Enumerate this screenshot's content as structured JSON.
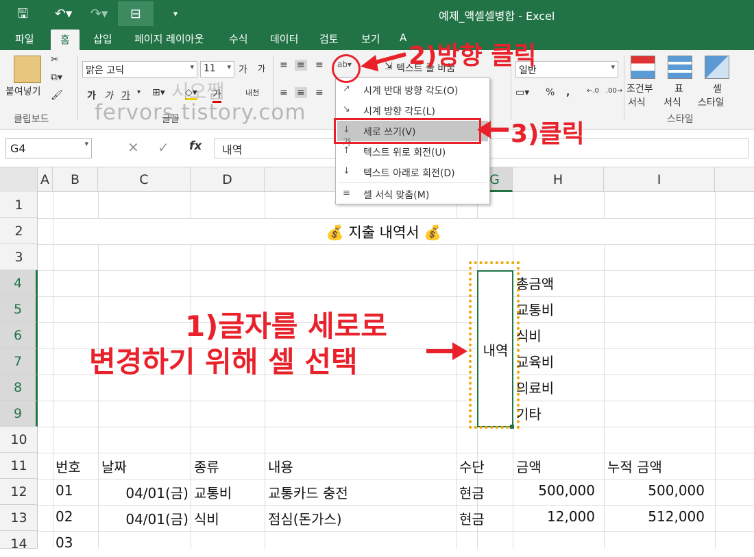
{
  "titlebar": {
    "title": "예제_액셀셀병합 - Excel"
  },
  "tabs": [
    "파일",
    "홈",
    "삽입",
    "페이지 레이아웃",
    "수식",
    "데이터",
    "검토",
    "보기",
    "A"
  ],
  "ribbon": {
    "paste_label": "붙여넣기",
    "clipboard_label": "클립보드",
    "font_name": "맑은 고딕",
    "font_size": "11",
    "font_group_label": "글꼴",
    "wrap_text": "텍스트 줄 바꿈",
    "number_format": "일반",
    "cond_format_1": "조건부",
    "cond_format_2": "서식",
    "table_format_1": "표",
    "table_format_2": "서식",
    "cell_style_1": "셀",
    "cell_style_2": "스타일",
    "style_group_label": "스타일",
    "bold": "가",
    "italic": "가",
    "underline": "가",
    "grow_font": "가",
    "shrink_font": "가",
    "font_color": "가",
    "phonetic": "내천",
    "percent": "%",
    "comma": ","
  },
  "formula": {
    "cell_ref": "G4",
    "value": "내역",
    "fx": "fx"
  },
  "columns": [
    "A",
    "B",
    "C",
    "D",
    "E",
    "F",
    "G",
    "H",
    "I"
  ],
  "rows": [
    "1",
    "2",
    "3",
    "4",
    "5",
    "6",
    "7",
    "8",
    "9",
    "10",
    "11",
    "12",
    "13",
    "14"
  ],
  "sheet": {
    "title": "💰 지출 내역서 💰",
    "merged_label": "내역",
    "categories": [
      "총금액",
      "교통비",
      "식비",
      "교육비",
      "의료비",
      "기타"
    ],
    "headers": {
      "no": "번호",
      "date": "날짜",
      "type": "종류",
      "content": "내용",
      "method": "수단",
      "amount": "금액",
      "cumulative": "누적 금액"
    },
    "records": [
      {
        "no": "01",
        "date": "04/01(금)",
        "type": "교통비",
        "content": "교통카드 충전",
        "method": "현금",
        "amount": "500,000",
        "cumulative": "500,000"
      },
      {
        "no": "02",
        "date": "04/01(금)",
        "type": "식비",
        "content": "점심(돈가스)",
        "method": "현금",
        "amount": "12,000",
        "cumulative": "512,000"
      },
      {
        "no": "03",
        "date": "",
        "type": "",
        "content": "",
        "method": "",
        "amount": "",
        "cumulative": ""
      }
    ]
  },
  "menu": {
    "items": [
      {
        "icon": "ccw-angle-icon",
        "glyph": "↗",
        "label": "시계 반대 방향 각도(O)"
      },
      {
        "icon": "cw-angle-icon",
        "glyph": "↘",
        "label": "시계 방향 각도(L)"
      },
      {
        "icon": "vertical-text-icon",
        "glyph": "↓가",
        "label": "세로 쓰기(V)"
      },
      {
        "icon": "rotate-up-icon",
        "glyph": "↑",
        "label": "텍스트 위로 회전(U)"
      },
      {
        "icon": "rotate-down-icon",
        "glyph": "↓",
        "label": "텍스트 아래로 회전(D)"
      },
      {
        "icon": "format-align-icon",
        "glyph": "≡",
        "label": "셀 서식 맞춤(M)"
      }
    ]
  },
  "annotations": {
    "step1_line1": "1)글자를 세로로",
    "step1_line2": "변경하기 위해 셀 선택",
    "step2": "2)방향 클릭",
    "step3": "3)클릭"
  },
  "watermark": {
    "line1": "시오쨈",
    "line2": "fervors.tistory.com"
  },
  "colors": {
    "excel_green": "#217346",
    "annotation_red": "#e8212a",
    "selection_dots": "#f0a500"
  }
}
